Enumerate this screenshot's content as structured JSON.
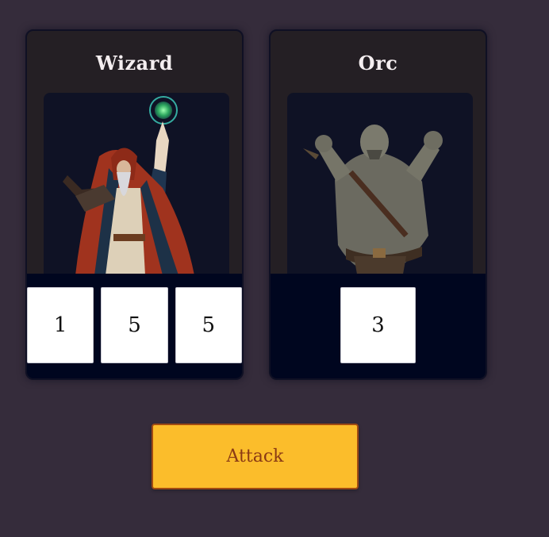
{
  "player": {
    "name": "Wizard",
    "portrait_icon": "wizard-character-icon",
    "dice": [
      "1",
      "5",
      "5"
    ]
  },
  "enemy": {
    "name": "Orc",
    "portrait_icon": "orc-character-icon",
    "dice": [
      "3"
    ]
  },
  "actions": {
    "attack_label": "Attack"
  },
  "colors": {
    "background": "#352c3b",
    "card": "#241f24",
    "dice_tray": "#00061f",
    "button": "#fbbd2b",
    "button_text": "#8a3a14"
  }
}
